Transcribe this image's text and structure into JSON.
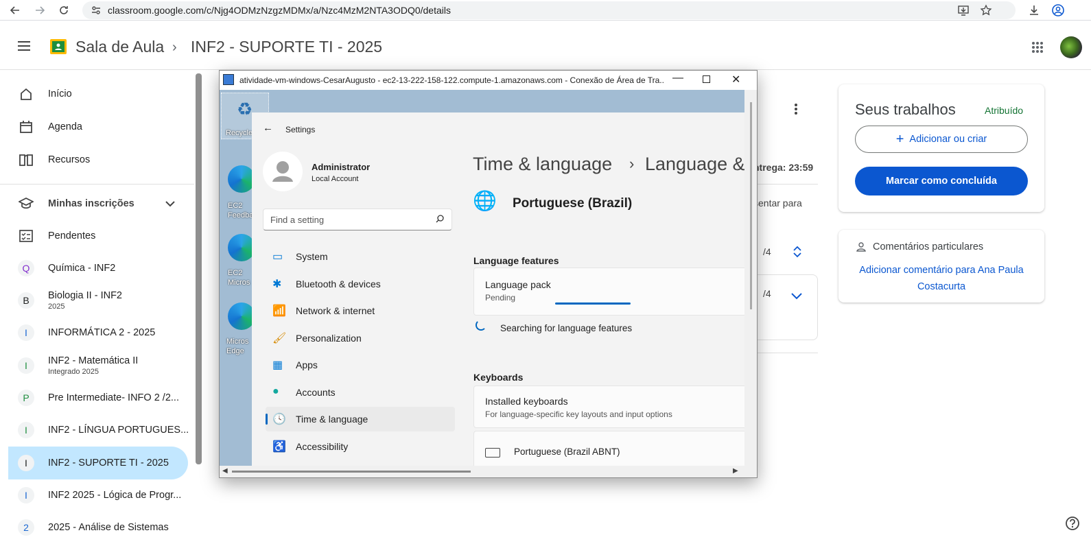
{
  "browser": {
    "url": "classroom.google.com/c/Njg4ODMzNzgzMDMx/a/Nzc4MzM2NTA3ODQ0/details"
  },
  "header": {
    "app_title": "Sala de Aula",
    "course": "INF2 - SUPORTE TI - 2025"
  },
  "sidebar": {
    "items": [
      {
        "label": "Início"
      },
      {
        "label": "Agenda"
      },
      {
        "label": "Recursos"
      }
    ],
    "enrollments_label": "Minhas inscrições",
    "pending_label": "Pendentes",
    "courses": [
      {
        "letter": "Q",
        "label": "Química - INF2",
        "sub": "",
        "color": "#8430ce"
      },
      {
        "letter": "B",
        "label": "Biologia II - INF2",
        "sub": "2025",
        "color": "#1f1f1f"
      },
      {
        "letter": "I",
        "label": "INFORMÁTICA 2 - 2025",
        "sub": "",
        "color": "#1967d2"
      },
      {
        "letter": "I",
        "label": "INF2 - Matemática II",
        "sub": "Integrado 2025",
        "color": "#1e8e3e"
      },
      {
        "letter": "P",
        "label": "Pre Intermediate- INFO 2 /2...",
        "sub": "",
        "color": "#1e8e3e"
      },
      {
        "letter": "I",
        "label": "INF2 - LÍNGUA PORTUGUES...",
        "sub": "",
        "color": "#1e8e3e"
      },
      {
        "letter": "I",
        "label": "INF2 - SUPORTE TI - 2025",
        "sub": "",
        "color": "#1f1f1f"
      },
      {
        "letter": "I",
        "label": "INF2 2025 - Lógica de Progr...",
        "sub": "",
        "color": "#1967d2"
      },
      {
        "letter": "2",
        "label": "2025 - Análise de Sistemas",
        "sub": "",
        "color": "#1967d2"
      }
    ]
  },
  "assignment": {
    "due": "ntrega: 23:59",
    "desc": "sentar para",
    "score1": "/4",
    "score2": "/4"
  },
  "work": {
    "title": "Seus trabalhos",
    "status": "Atribuído",
    "add_label": "Adicionar ou criar",
    "done_label": "Marcar como concluída"
  },
  "comments": {
    "title": "Comentários particulares",
    "add_label": "Adicionar comentário para Ana Paula Costacurta"
  },
  "rdp": {
    "title": "atividade-vm-windows-CesarAugusto - ec2-13-222-158-122.compute-1.amazonaws.com - Conexão de Área de Tra...",
    "desktop_icons": [
      {
        "label": "Recycle"
      },
      {
        "label": "EC2 Feedba"
      },
      {
        "label": "EC2 Micros"
      },
      {
        "label": "Micros Edge"
      }
    ],
    "settings": {
      "title": "Settings",
      "user_name": "Administrator",
      "user_type": "Local Account",
      "search_placeholder": "Find a setting",
      "nav": [
        {
          "label": "System"
        },
        {
          "label": "Bluetooth & devices"
        },
        {
          "label": "Network & internet"
        },
        {
          "label": "Personalization"
        },
        {
          "label": "Apps"
        },
        {
          "label": "Accounts"
        },
        {
          "label": "Time & language"
        },
        {
          "label": "Accessibility"
        }
      ],
      "breadcrumb1": "Time & language",
      "breadcrumb2": "Language &",
      "language": "Portuguese (Brazil)",
      "features_heading": "Language features",
      "pack_title": "Language pack",
      "pack_status": "Pending",
      "searching": "Searching for language features",
      "keyboards_heading": "Keyboards",
      "installed_title": "Installed keyboards",
      "installed_sub": "For language-specific key layouts and input options",
      "keyboard_item": "Portuguese (Brazil ABNT)"
    }
  }
}
